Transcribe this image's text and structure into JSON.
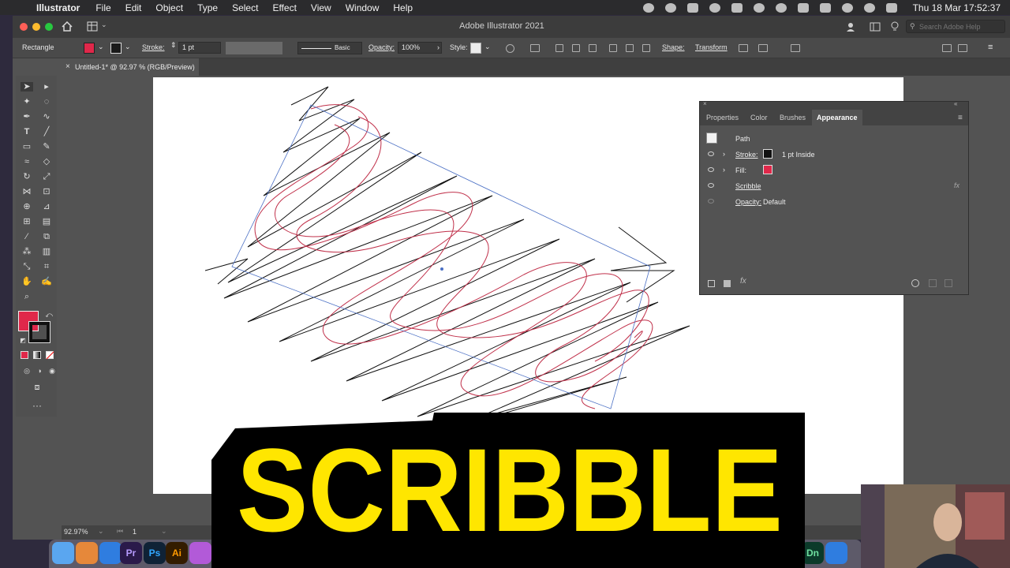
{
  "menubar": {
    "app": "Illustrator",
    "items": [
      "File",
      "Edit",
      "Object",
      "Type",
      "Select",
      "Effect",
      "View",
      "Window",
      "Help"
    ],
    "clock": "Thu 18 Mar  17:52:37"
  },
  "window": {
    "title": "Adobe Illustrator 2021",
    "search_placeholder": "Search Adobe Help"
  },
  "controlbar": {
    "selection": "Rectangle",
    "stroke_label": "Stroke:",
    "stroke_value": "1 pt",
    "brush": "Basic",
    "opacity_label": "Opacity:",
    "opacity_value": "100%",
    "style_label": "Style:",
    "shape_label": "Shape:",
    "transform_label": "Transform",
    "fill_color": "#e0284a",
    "stroke_color": "#000000"
  },
  "document": {
    "tab": "Untitled-1* @ 92.97 % (RGB/Preview)"
  },
  "statusbar": {
    "zoom": "92.97%",
    "artboard": "1"
  },
  "appearance": {
    "tabs": [
      "Properties",
      "Color",
      "Brushes",
      "Appearance"
    ],
    "active_tab": "Appearance",
    "title": "Path",
    "stroke_label": "Stroke:",
    "stroke_detail": "1 pt  Inside",
    "fill_label": "Fill:",
    "effect": "Scribble",
    "opacity_label": "Opacity:",
    "opacity_value": "Default",
    "fx": "fx"
  },
  "overlay": {
    "headline": "SCRIBBLE",
    "color": "#ffe600"
  },
  "dock": {
    "apps": [
      "Pr",
      "Ps",
      "Ai",
      "Dn"
    ]
  }
}
